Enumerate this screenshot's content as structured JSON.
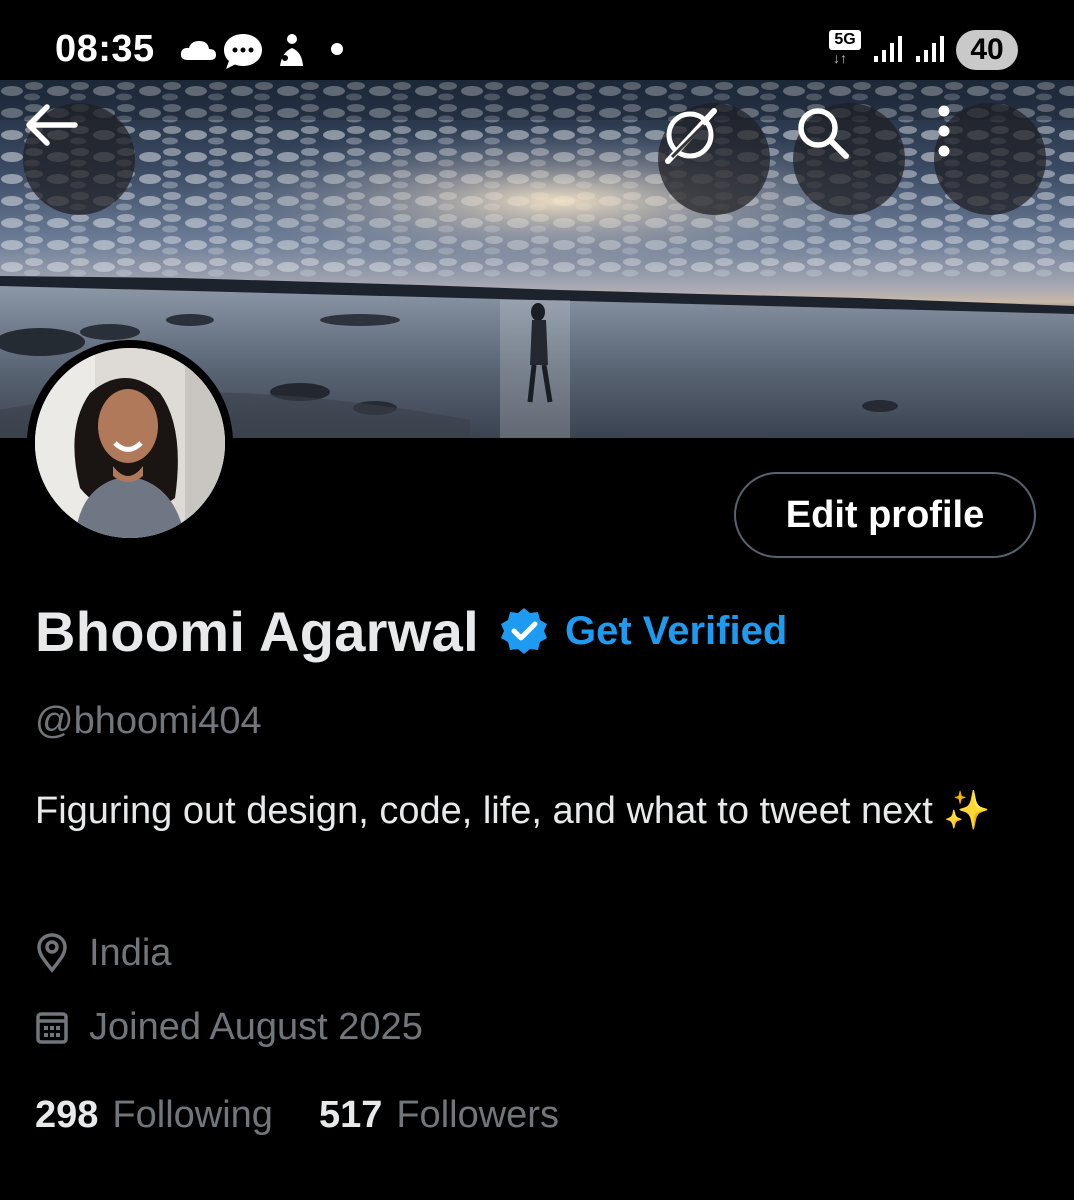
{
  "status_bar": {
    "time": "08:35",
    "icons": [
      "cloud-icon",
      "chat-bubble-icon",
      "notification-icon",
      "dot-icon"
    ],
    "network": "5G",
    "battery": "40"
  },
  "header": {
    "back_icon": "arrow-left-icon",
    "grok_icon": "grok-icon",
    "search_icon": "search-icon",
    "more_icon": "more-vertical-icon"
  },
  "profile": {
    "edit_label": "Edit profile",
    "display_name": "Bhoomi Agarwal",
    "get_verified_label": "Get Verified",
    "handle": "@bhoomi404",
    "bio": "Figuring out design, code, life, and what to tweet next ✨",
    "location": "India",
    "joined": "Joined August 2025",
    "following_count": "298",
    "following_label": "Following",
    "followers_count": "517",
    "followers_label": "Followers"
  },
  "colors": {
    "background": "#000000",
    "accent": "#1d9bf0",
    "muted_text": "#71767b",
    "primary_text": "#e7e9ea"
  }
}
